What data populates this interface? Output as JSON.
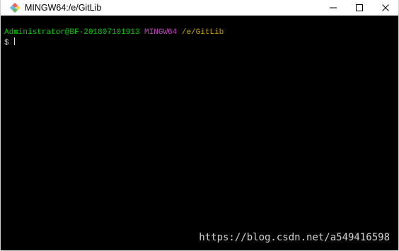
{
  "window": {
    "title": "MINGW64:/e/GitLib",
    "icon": "git-diamond-icon",
    "controls": [
      "minimize-icon",
      "maximize-icon",
      "close-icon"
    ]
  },
  "terminal": {
    "prompt_user_host": "Administrator@BF-201807101913",
    "prompt_system": "MINGW64",
    "prompt_path": "/e/GitLib",
    "prompt_symbol": "$"
  },
  "colors": {
    "user_host": "#00c800",
    "system": "#bf3fbf",
    "path": "#c0a000",
    "background": "#000000"
  },
  "watermark": {
    "text": "https://blog.csdn.net/a549416598"
  }
}
